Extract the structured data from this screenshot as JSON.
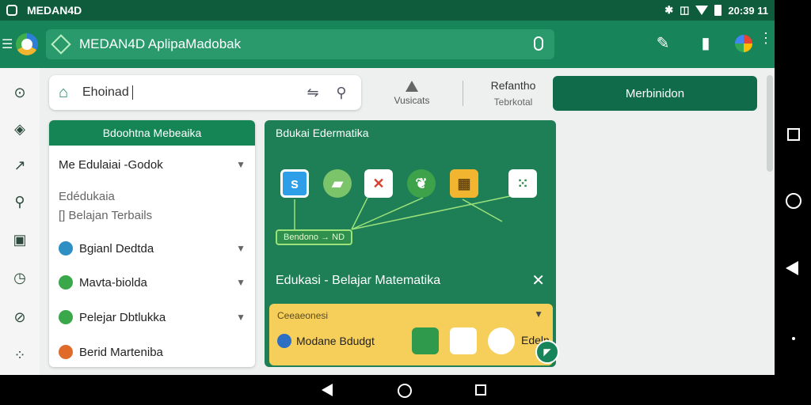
{
  "status": {
    "app_name": "MEDAN4D",
    "time": "20:39 11"
  },
  "appbar": {
    "title": "MEDAN4D AplipaMadobak"
  },
  "toolbar": {
    "search_value": "Ehoinad",
    "tri_label": "Vusicats",
    "text_btn_top": "Refantho",
    "text_btn_bottom": "Tebrkotal",
    "primary_label": "Merbinidon"
  },
  "left_panel": {
    "header": "Bdoohtna Mebeaika",
    "items": [
      {
        "label": "Me Edulaiai -Godok"
      },
      {
        "label": "Edédukaia"
      },
      {
        "label": "Belajan Terbails",
        "prefix": "[] "
      },
      {
        "label": "Bgianl Dedtda"
      },
      {
        "label": "Mavta-biolda"
      },
      {
        "label": "Pelejar Dbtlukka"
      },
      {
        "label": "Berid Marteniba"
      }
    ]
  },
  "card": {
    "header": "Bdukai Edermatika",
    "chip": "Bendono → ND",
    "title": "Edukasi - Belajar Matematika",
    "sub_label": "Ceeaeonesi",
    "sub_row": "Modane Bdudgt",
    "sub_right": "Edeln"
  },
  "colors": {
    "primary": "#17845a",
    "dark": "#0f5c3c",
    "card": "#1e7e55",
    "yellow": "#f6cf5a"
  }
}
